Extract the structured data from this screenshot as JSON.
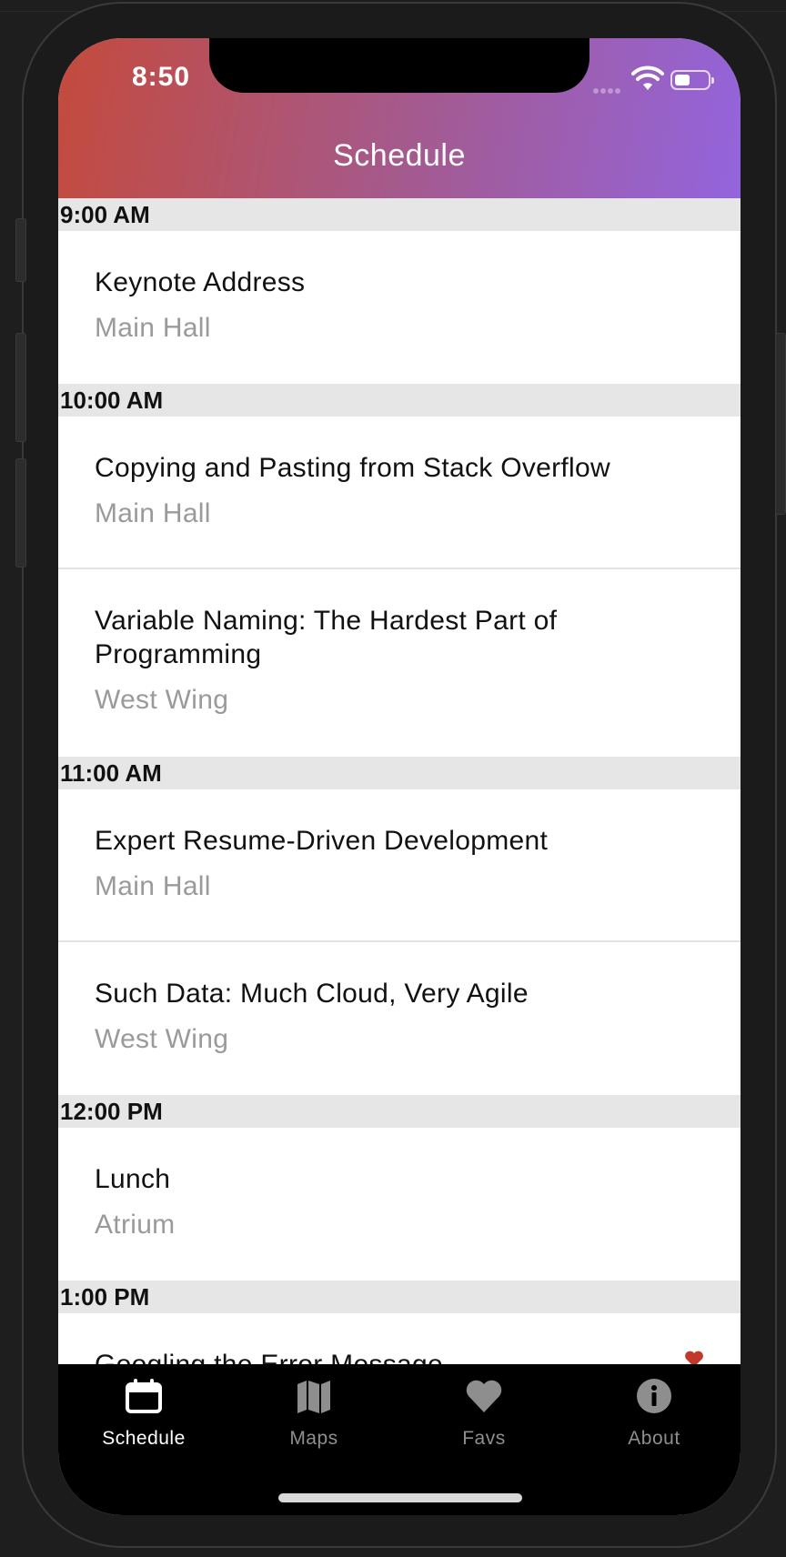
{
  "status_bar": {
    "time": "8:50"
  },
  "header": {
    "title": "Schedule"
  },
  "sections": [
    {
      "time": "9:00 AM",
      "sessions": [
        {
          "title": "Keynote Address",
          "room": "Main Hall"
        }
      ]
    },
    {
      "time": "10:00 AM",
      "sessions": [
        {
          "title": "Copying and Pasting from Stack Overflow",
          "room": "Main Hall"
        },
        {
          "title": "Variable Naming: The Hardest Part of Programming",
          "room": "West Wing"
        }
      ]
    },
    {
      "time": "11:00 AM",
      "sessions": [
        {
          "title": "Expert Resume-Driven Development",
          "room": "Main Hall"
        },
        {
          "title": "Such Data: Much Cloud, Very Agile",
          "room": "West Wing"
        }
      ]
    },
    {
      "time": "12:00 PM",
      "sessions": [
        {
          "title": "Lunch",
          "room": "Atrium"
        }
      ]
    },
    {
      "time": "1:00 PM",
      "sessions": [
        {
          "title": "Googling the Error Message",
          "room": "",
          "favorite": true
        }
      ]
    }
  ],
  "tabbar": {
    "tabs": [
      {
        "label": "Schedule",
        "icon": "calendar-icon",
        "active": true
      },
      {
        "label": "Maps",
        "icon": "map-icon",
        "active": false
      },
      {
        "label": "Favs",
        "icon": "heart-icon",
        "active": false
      },
      {
        "label": "About",
        "icon": "info-icon",
        "active": false
      }
    ]
  },
  "colors": {
    "header_gradient_start": "#c44a3c",
    "header_gradient_end": "#9364dd",
    "favorite_heart": "#c0392b",
    "tab_active": "#ffffff",
    "tab_inactive": "#8e8e8e"
  }
}
